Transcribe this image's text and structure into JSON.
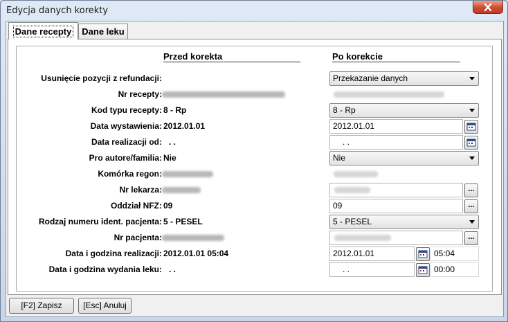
{
  "window": {
    "title": "Edycja danych korekty"
  },
  "tabs": [
    {
      "label": "Dane recepty",
      "active": true
    },
    {
      "label": "Dane leku",
      "active": false
    }
  ],
  "columns": {
    "before": "Przed korekta",
    "after": "Po korekcie"
  },
  "rows": {
    "usuniecie": {
      "label": "Usunięcie pozycji z refundacji:",
      "after": "Przekazanie danych"
    },
    "nr_recepty": {
      "label": "Nr recepty:"
    },
    "kod_typu": {
      "label": "Kod typu recepty:",
      "before": "8 - Rp",
      "after": "8 - Rp"
    },
    "data_wystawienia": {
      "label": "Data wystawienia:",
      "before": "2012.01.01",
      "after": "2012.01.01"
    },
    "data_realizacji_od": {
      "label": "Data realizacji od:",
      "before": ". .",
      "after": ". ."
    },
    "pro_autore": {
      "label": "Pro autore/familia:",
      "before": "Nie",
      "after": "Nie"
    },
    "komorka": {
      "label": "Komórka regon:"
    },
    "nr_lekarza": {
      "label": "Nr lekarza:"
    },
    "oddzial": {
      "label": "Oddział NFZ:",
      "before": "09",
      "after": "09"
    },
    "rodzaj": {
      "label": "Rodzaj numeru ident. pacjenta:",
      "before": "5 - PESEL",
      "after": "5 - PESEL"
    },
    "nr_pacjenta": {
      "label": "Nr pacjenta:"
    },
    "data_godz_realizacji": {
      "label": "Data i godzina realizacji:",
      "before": "2012.01.01 05:04",
      "after_date": "2012.01.01",
      "after_time": "05:04"
    },
    "data_godz_wydania": {
      "label": "Data i godzina wydania leku:",
      "before": ". .",
      "after_date": ". .",
      "after_time": "00:00"
    }
  },
  "buttons": {
    "dots": "...",
    "save": "[F2] Zapisz",
    "cancel": "[Esc] Anuluj"
  },
  "icons": {
    "close": "close-icon",
    "calendar": "calendar-icon"
  }
}
